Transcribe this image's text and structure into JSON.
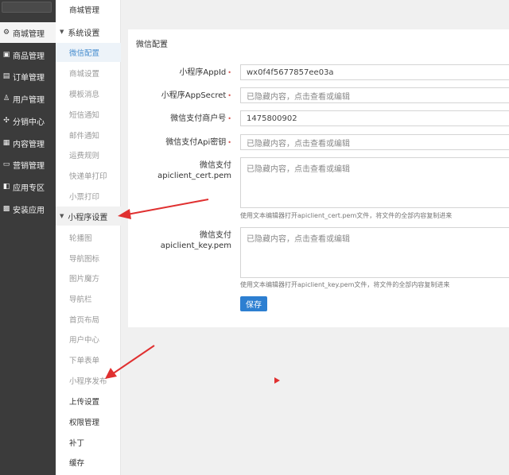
{
  "sidebar": {
    "items": [
      {
        "label": "商城管理",
        "icon": "gear-icon"
      },
      {
        "label": "商品管理",
        "icon": "store-icon"
      },
      {
        "label": "订单管理",
        "icon": "order-icon"
      },
      {
        "label": "用户管理",
        "icon": "user-icon"
      },
      {
        "label": "分销中心",
        "icon": "network-icon"
      },
      {
        "label": "内容管理",
        "icon": "content-icon"
      },
      {
        "label": "营销管理",
        "icon": "marketing-icon"
      },
      {
        "label": "应用专区",
        "icon": "apps-icon"
      },
      {
        "label": "安装应用",
        "icon": "install-icon"
      }
    ]
  },
  "submenu": {
    "top_item": "商城管理",
    "group_system": "系统设置",
    "system_items": [
      "微信配置",
      "商城设置",
      "模板消息",
      "短信通知",
      "邮件通知",
      "运费规则",
      "快递单打印",
      "小票打印"
    ],
    "group_miniapp": "小程序设置",
    "miniapp_items": [
      "轮播图",
      "导航图标",
      "图片魔方",
      "导航栏",
      "首页布局",
      "用户中心",
      "下单表单",
      "小程序发布",
      "上传设置",
      "权限管理",
      "补丁",
      "缓存"
    ]
  },
  "panel": {
    "title": "微信配置",
    "fields": {
      "appid": {
        "label": "小程序AppId",
        "value": "wx0f4f5677857ee03a"
      },
      "appsecret": {
        "label": "小程序AppSecret",
        "value": "已隐藏内容，点击查看或编辑"
      },
      "mchid": {
        "label": "微信支付商户号",
        "value": "1475800902"
      },
      "apikey": {
        "label": "微信支付Api密钥",
        "value": "已隐藏内容，点击查看或编辑"
      },
      "cert": {
        "label_line1": "微信支付",
        "label_line2": "apiclient_cert.pem",
        "value": "已隐藏内容，点击查看或编辑",
        "hint": "使用文本编辑器打开apiclient_cert.pem文件，将文件的全部内容复制进来"
      },
      "key": {
        "label_line1": "微信支付",
        "label_line2": "apiclient_key.pem",
        "value": "已隐藏内容，点击查看或编辑",
        "hint": "使用文本编辑器打开apiclient_key.pem文件，将文件的全部内容复制进来"
      }
    },
    "save_label": "保存"
  },
  "colors": {
    "sidebar_bg": "#3b3b3b",
    "primary": "#2d7fd1",
    "annotation_arrow": "#e03030"
  }
}
